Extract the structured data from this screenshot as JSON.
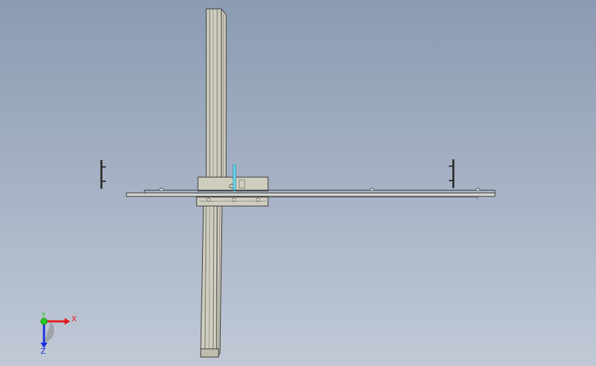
{
  "viewport": {
    "background_top": "#8b9bb3",
    "background_bottom": "#c1c9d6"
  },
  "colors": {
    "part_fill": "#c9c7b6",
    "part_edge": "#3a3a3a",
    "shaft_fill": "#d6d6d0",
    "highlight": "#49c0d8"
  },
  "triad": {
    "x_label": "X",
    "y_label": "Y",
    "z_label": "Z",
    "x_color": "#e21a1a",
    "y_color": "#22cc22",
    "z_color": "#1a2ee0"
  }
}
